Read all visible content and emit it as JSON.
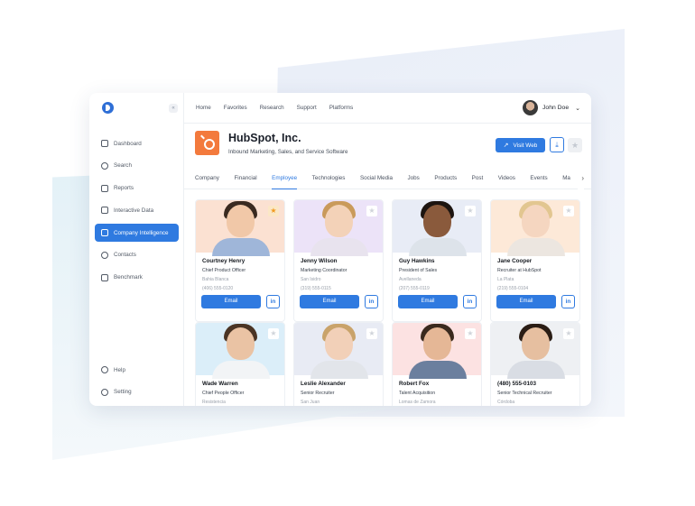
{
  "sidebar": {
    "collapse_icon": "«",
    "items": [
      {
        "label": "Dashboard",
        "icon": "grid-icon"
      },
      {
        "label": "Search",
        "icon": "search-icon"
      },
      {
        "label": "Reports",
        "icon": "document-icon"
      },
      {
        "label": "Interactive Data",
        "icon": "database-icon"
      },
      {
        "label": "Company Intelligence",
        "icon": "building-icon",
        "active": true
      },
      {
        "label": "Contacts",
        "icon": "users-icon"
      },
      {
        "label": "Benchmark",
        "icon": "server-icon"
      }
    ],
    "bottom": [
      {
        "label": "Help",
        "icon": "help-icon"
      },
      {
        "label": "Setting",
        "icon": "gear-icon"
      }
    ]
  },
  "topbar": {
    "links": [
      "Home",
      "Favorites",
      "Research",
      "Support",
      "Platforms"
    ],
    "user_name": "John Doe",
    "chevron": "⌄"
  },
  "company": {
    "name": "HubSpot, Inc.",
    "description": "Inbound Marketing, Sales, and Service Software",
    "visit_label": "Visit Web",
    "brand_color": "#F37A3D"
  },
  "tabs": [
    "Company",
    "Financial",
    "Employee",
    "Technologies",
    "Social Media",
    "Jobs",
    "Products",
    "Post",
    "Videos",
    "Events",
    "Ma"
  ],
  "active_tab": "Employee",
  "card_actions": {
    "email_label": "Email",
    "linkedin_label": "in"
  },
  "employees": [
    {
      "name": "Courtney Henry",
      "role": "Chief Product Officer",
      "location": "Bahia Blanca",
      "phone": "(406) 555-0120",
      "starred": true,
      "bg": "#fbe1d2"
    },
    {
      "name": "Jenny Wilson",
      "role": "Marketing Coordinator",
      "location": "San Isidro",
      "phone": "(319) 555-0115",
      "starred": false,
      "bg": "#ece3f8"
    },
    {
      "name": "Guy Hawkins",
      "role": "President of Sales",
      "location": "Avellaneda",
      "phone": "(207) 555-0119",
      "starred": false,
      "bg": "#e8ecf6"
    },
    {
      "name": "Jane Cooper",
      "role": "Recruiter at HubSpot",
      "location": "La Plata",
      "phone": "(219) 555-0104",
      "starred": false,
      "bg": "#fde9d8"
    },
    {
      "name": "Wade Warren",
      "role": "Chief People Officer",
      "location": "Resistencia",
      "phone": "",
      "starred": false,
      "bg": "#dbeef9"
    },
    {
      "name": "Leslie Alexander",
      "role": "Senior Recruiter",
      "location": "San Juan",
      "phone": "",
      "starred": false,
      "bg": "#e8ebf4"
    },
    {
      "name": "Robert Fox",
      "role": "Talent Acquisition",
      "location": "Lomas de Zamora",
      "phone": "",
      "starred": false,
      "bg": "#fce2e2"
    },
    {
      "name": "(480) 555-0103",
      "role": "Senior Technical Recruiter",
      "location": "Córdoba",
      "phone": "",
      "starred": false,
      "bg": "#eef0f3"
    }
  ]
}
